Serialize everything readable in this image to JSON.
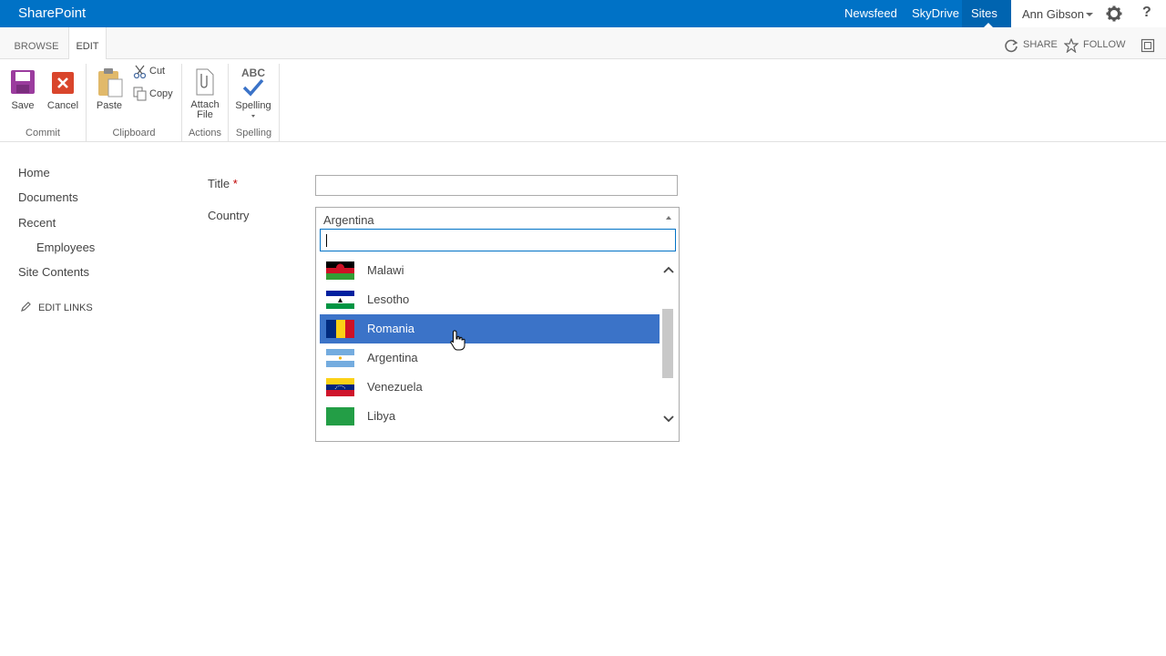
{
  "suite": {
    "brand": "SharePoint",
    "links": [
      "Newsfeed",
      "SkyDrive",
      "Sites"
    ],
    "user": "Ann Gibson",
    "help": "?"
  },
  "ribbon_tabs": {
    "browse": "BROWSE",
    "edit": "EDIT"
  },
  "top_actions": {
    "share": "SHARE",
    "follow": "FOLLOW"
  },
  "ribbon": {
    "save": "Save",
    "cancel": "Cancel",
    "paste": "Paste",
    "cut": "Cut",
    "copy": "Copy",
    "attach_line1": "Attach",
    "attach_line2": "File",
    "spelling_abc": "ABC",
    "spelling": "Spelling",
    "groups": {
      "commit": "Commit",
      "clipboard": "Clipboard",
      "actions": "Actions",
      "spelling": "Spelling"
    }
  },
  "nav": {
    "home": "Home",
    "documents": "Documents",
    "recent": "Recent",
    "employees": "Employees",
    "site_contents": "Site Contents",
    "edit_links": "EDIT LINKS"
  },
  "form": {
    "title_label": "Title",
    "required_mark": "*",
    "title_value": "",
    "country_label": "Country",
    "country_value": "Argentina",
    "search_value": ""
  },
  "dropdown_options": [
    {
      "name": "Malawi",
      "selected": false
    },
    {
      "name": "Lesotho",
      "selected": false
    },
    {
      "name": "Romania",
      "selected": true
    },
    {
      "name": "Argentina",
      "selected": false
    },
    {
      "name": "Venezuela",
      "selected": false
    },
    {
      "name": "Libya",
      "selected": false
    }
  ],
  "colors": {
    "suite_bar": "#0072c6",
    "selection": "#3b73c8",
    "required": "#bf0000"
  }
}
